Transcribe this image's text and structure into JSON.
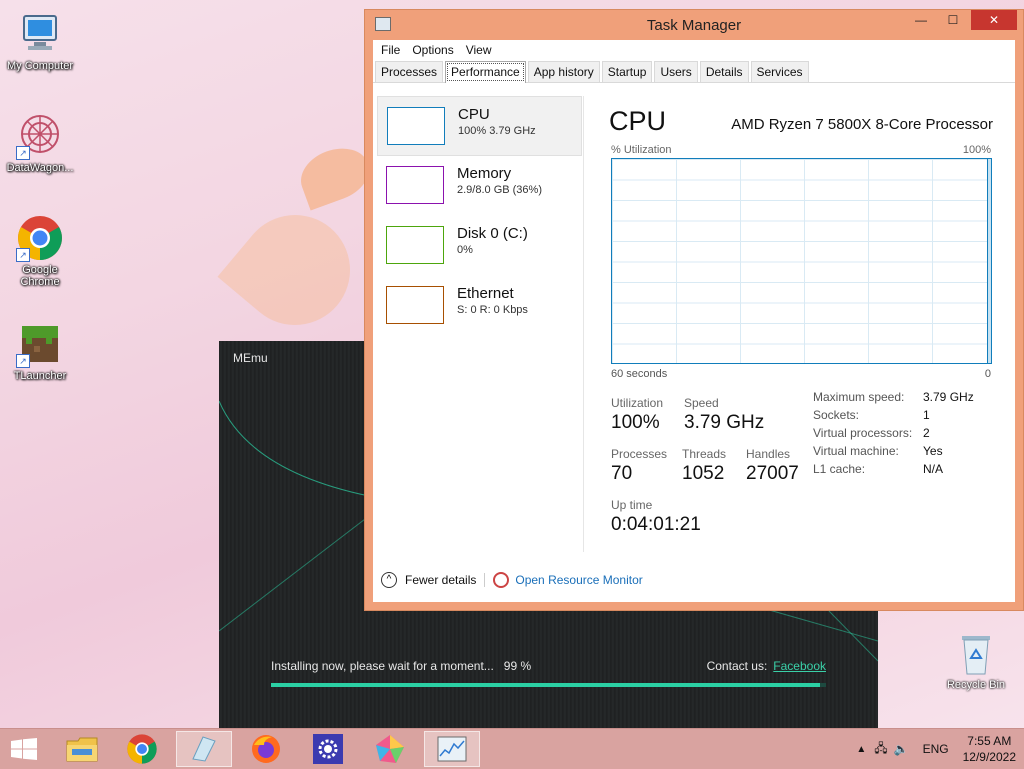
{
  "desktop": {
    "icons": [
      {
        "label": "My Computer"
      },
      {
        "label": "DataWagon..."
      },
      {
        "label": "Google Chrome"
      },
      {
        "label": "TLauncher"
      }
    ],
    "recycle_bin": "Recycle Bin"
  },
  "memu": {
    "title": "MEmu",
    "status": "Installing now, please wait for a moment...",
    "percent_text": "99 %",
    "progress": 0.99,
    "contact_label": "Contact us:",
    "contact_link": "Facebook"
  },
  "taskmgr": {
    "title": "Task Manager",
    "menu": [
      "File",
      "Options",
      "View"
    ],
    "tabs": [
      "Processes",
      "Performance",
      "App history",
      "Startup",
      "Users",
      "Details",
      "Services"
    ],
    "active_tab": "Performance",
    "resources": [
      {
        "name": "CPU",
        "sub": "100%  3.79 GHz",
        "color": "#117dbb"
      },
      {
        "name": "Memory",
        "sub": "2.9/8.0 GB (36%)",
        "color": "#8b12ae"
      },
      {
        "name": "Disk 0 (C:)",
        "sub": "0%",
        "color": "#4da60c"
      },
      {
        "name": "Ethernet",
        "sub": "S: 0  R: 0 Kbps",
        "color": "#a74f01"
      }
    ],
    "detail": {
      "heading": "CPU",
      "cpu_name": "AMD Ryzen 7 5800X 8-Core Processor",
      "util_label": "% Utilization",
      "util_max": "100%",
      "time_span": "60 seconds",
      "time_end": "0",
      "utilization_label": "Utilization",
      "utilization": "100%",
      "speed_label": "Speed",
      "speed": "3.79 GHz",
      "processes_label": "Processes",
      "processes": "70",
      "threads_label": "Threads",
      "threads": "1052",
      "handles_label": "Handles",
      "handles": "27007",
      "uptime_label": "Up time",
      "uptime": "0:04:01:21",
      "specs": [
        {
          "k": "Maximum speed:",
          "v": "3.79 GHz"
        },
        {
          "k": "Sockets:",
          "v": "1"
        },
        {
          "k": "Virtual processors:",
          "v": "2"
        },
        {
          "k": "Virtual machine:",
          "v": "Yes"
        },
        {
          "k": "L1 cache:",
          "v": "N/A"
        }
      ]
    },
    "footer": {
      "fewer": "Fewer details",
      "monitor": "Open Resource Monitor"
    }
  },
  "taskbar": {
    "language": "ENG",
    "time": "7:55 AM",
    "date": "12/9/2022"
  }
}
